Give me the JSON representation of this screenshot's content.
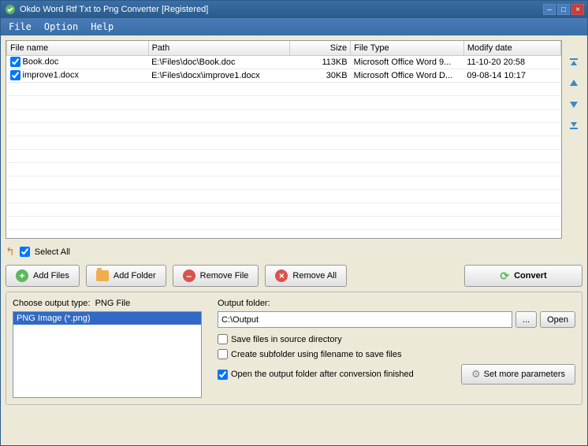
{
  "title": "Okdo Word Rtf Txt to Png Converter [Registered]",
  "menu": {
    "file": "File",
    "option": "Option",
    "help": "Help"
  },
  "columns": {
    "name": "File name",
    "path": "Path",
    "size": "Size",
    "type": "File Type",
    "date": "Modify date"
  },
  "files": [
    {
      "name": "Book.doc",
      "path": "E:\\Files\\doc\\Book.doc",
      "size": "113KB",
      "type": "Microsoft Office Word 9...",
      "date": "11-10-20 20:58"
    },
    {
      "name": "improve1.docx",
      "path": "E:\\Files\\docx\\improve1.docx",
      "size": "30KB",
      "type": "Microsoft Office Word D...",
      "date": "09-08-14 10:17"
    }
  ],
  "selectAll": "Select All",
  "buttons": {
    "addFiles": "Add Files",
    "addFolder": "Add Folder",
    "removeFile": "Remove File",
    "removeAll": "Remove All",
    "convert": "Convert"
  },
  "outputTypeLabel": "Choose output type:",
  "outputTypeValue": "PNG File",
  "outputTypes": {
    "png": "PNG Image (*.png)"
  },
  "outputFolderLabel": "Output folder:",
  "outputFolderValue": "C:\\Output",
  "browse": "...",
  "open": "Open",
  "checks": {
    "saveSource": "Save files in source directory",
    "createSub": "Create subfolder using filename to save files",
    "openAfter": "Open the output folder after conversion finished"
  },
  "setParams": "Set more parameters"
}
